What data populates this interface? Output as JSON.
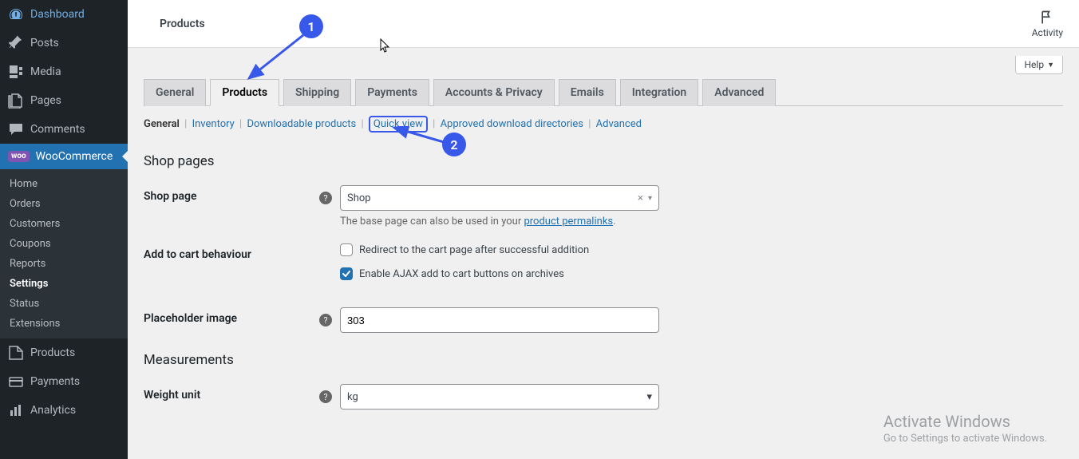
{
  "sidebar": {
    "dashboard": "Dashboard",
    "posts": "Posts",
    "media": "Media",
    "pages": "Pages",
    "comments": "Comments",
    "woocommerce": "WooCommerce",
    "wc_sub": {
      "home": "Home",
      "orders": "Orders",
      "customers": "Customers",
      "coupons": "Coupons",
      "reports": "Reports",
      "settings": "Settings",
      "status": "Status",
      "extensions": "Extensions"
    },
    "products": "Products",
    "payments": "Payments",
    "analytics": "Analytics"
  },
  "topbar": {
    "title": "Products",
    "activity": "Activity",
    "help": "Help"
  },
  "tabs": {
    "general": "General",
    "products": "Products",
    "shipping": "Shipping",
    "payments": "Payments",
    "accounts": "Accounts & Privacy",
    "emails": "Emails",
    "integration": "Integration",
    "advanced": "Advanced"
  },
  "sublinks": {
    "general": "General",
    "inventory": "Inventory",
    "downloadable": "Downloadable products",
    "quickview": "Quick view",
    "approved": "Approved download directories",
    "advanced": "Advanced"
  },
  "sections": {
    "shop_pages": "Shop pages",
    "measurements": "Measurements"
  },
  "form": {
    "shop_page_label": "Shop page",
    "shop_page_value": "Shop",
    "shop_page_hint_pre": "The base page can also be used in your ",
    "shop_page_hint_link": "product permalinks",
    "shop_page_hint_post": ".",
    "add_to_cart_label": "Add to cart behaviour",
    "redirect_label": "Redirect to the cart page after successful addition",
    "redirect_checked": false,
    "ajax_label": "Enable AJAX add to cart buttons on archives",
    "ajax_checked": true,
    "placeholder_label": "Placeholder image",
    "placeholder_value": "303",
    "weight_label": "Weight unit",
    "weight_value": "kg"
  },
  "annotations": {
    "n1": "1",
    "n2": "2"
  },
  "watermark": {
    "title": "Activate Windows",
    "sub": "Go to Settings to activate Windows."
  }
}
